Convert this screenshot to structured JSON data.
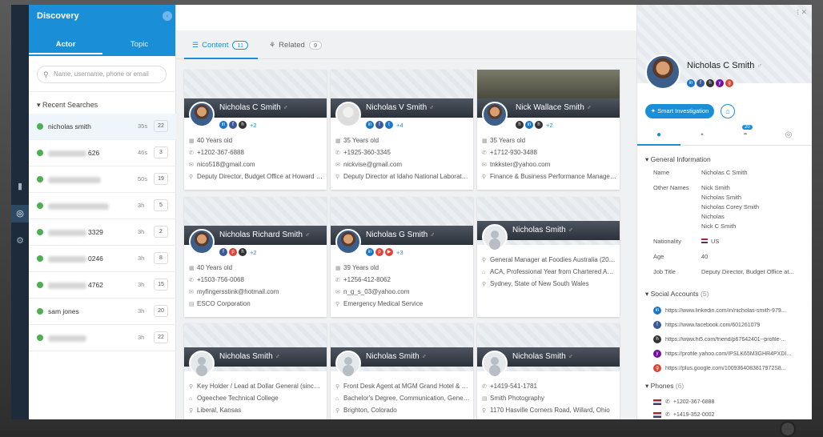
{
  "sidebar": {
    "title": "Discovery",
    "tabs": [
      "Actor",
      "Topic"
    ],
    "search_placeholder": "Name, username, phone or email",
    "recent_heading": "Recent Searches",
    "items": [
      {
        "name": "nicholas smith",
        "time": "35s",
        "count": "22"
      },
      {
        "name": "626",
        "time": "46s",
        "count": "3"
      },
      {
        "name": "",
        "time": "50s",
        "count": "19"
      },
      {
        "name": "",
        "time": "3h",
        "count": "5"
      },
      {
        "name": "3329",
        "time": "3h",
        "count": "2"
      },
      {
        "name": "0246",
        "time": "3h",
        "count": "8"
      },
      {
        "name": "4762",
        "time": "3h",
        "count": "15"
      },
      {
        "name": "sam jones",
        "time": "3h",
        "count": "20"
      },
      {
        "name": "",
        "time": "3h",
        "count": "22"
      }
    ]
  },
  "main": {
    "tabs": [
      {
        "label": "Content",
        "count": "11"
      },
      {
        "label": "Related",
        "count": "9"
      }
    ],
    "cards": [
      {
        "name": "Nicholas C Smith",
        "more": "+2",
        "lines": [
          "40 Years old",
          "+1202-367-6888",
          "nico518@gmail.com",
          "Deputy Director, Budget Office at Howard Univ..."
        ]
      },
      {
        "name": "Nicholas V Smith",
        "more": "+4",
        "lines": [
          "35 Years old",
          "+1925-360-3345",
          "nickvise@gmail.com",
          "Deputy Director at Idaho National Laboratory (..."
        ]
      },
      {
        "name": "Nick Wallace Smith",
        "more": "+2",
        "lines": [
          "35 Years old",
          "+1712-930-3488",
          "tnkkster@yahoo.com",
          "Finance & Business Performance Manager at ..."
        ]
      },
      {
        "name": "Nicholas Richard Smith",
        "more": "+2",
        "lines": [
          "40 Years old",
          "+1503-756-0068",
          "myfingersstink@hotmail.com",
          "ESCO Corporation"
        ]
      },
      {
        "name": "Nicholas G Smith",
        "more": "+3",
        "lines": [
          "39 Years old",
          "+1256-412-8062",
          "n_g_s_03@yahoo.com",
          "Emergency Medical Service"
        ]
      },
      {
        "name": "Nicholas Smith",
        "more": "",
        "lines": [
          "General Manager at Foodies Australia (2014-2...",
          "ACA, Professional Year from Chartered Accou...",
          "Sydney, State of New South Wales"
        ]
      },
      {
        "name": "Nicholas Smith",
        "more": "",
        "lines": [
          "Key Holder / Lead at Dollar General (since 201...",
          "Ogeechee Technical College",
          "Liberal, Kansas"
        ]
      },
      {
        "name": "Nicholas Smith",
        "more": "",
        "lines": [
          "Front Desk Agent at MGM Grand Hotel & Casi...",
          "Bachelor's Degree, Communication, General fr...",
          "Brighton, Colorado"
        ]
      },
      {
        "name": "Nicholas Smith",
        "more": "",
        "lines": [
          "+1419-541-1781",
          "Smith Photography",
          "1170 Hasville Corners Road, Willard, Ohio"
        ]
      }
    ]
  },
  "profile": {
    "name": "Nicholas C Smith",
    "smart_btn": "Smart Investigation",
    "tab_badge": "20",
    "general_heading": "General Information",
    "fields": [
      {
        "k": "Name",
        "v": [
          "Nicholas C Smith"
        ]
      },
      {
        "k": "Other Names",
        "v": [
          "Nick Smith",
          "Nicholas Smith",
          "Nicholas Corey Smith",
          "Nicholas",
          "Nick C Smith"
        ]
      },
      {
        "k": "Nationality",
        "v": [
          "US"
        ]
      },
      {
        "k": "Age",
        "v": [
          "40"
        ]
      },
      {
        "k": "Job Title",
        "v": [
          "Deputy Director, Budget Office at..."
        ]
      }
    ],
    "social_heading": "Social Accounts",
    "social_count": "(5)",
    "accounts": [
      {
        "icon": "linkedin-icon",
        "url": "https://www.linkedin.com/in/nicholas-smith-979..."
      },
      {
        "icon": "facebook-icon",
        "url": "https://www.facebook.com/601261079"
      },
      {
        "icon": "hi5-icon",
        "url": "https://www.hi5.com/friend/p67642401--profile-..."
      },
      {
        "icon": "yahoo-icon",
        "url": "https://profile.yahoo.com/IPSLK65M3GHR4PXDI..."
      },
      {
        "icon": "googleplus-icon",
        "url": "https://plus.google.com/1009364083817972S8..."
      }
    ],
    "phones_heading": "Phones",
    "phones_count": "(6)",
    "phones": [
      "+1202-367-6888",
      "+1419-352-0002"
    ]
  }
}
